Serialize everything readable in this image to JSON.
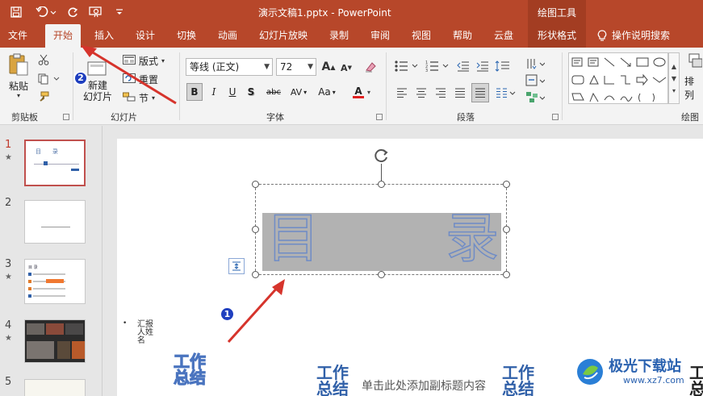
{
  "titlebar": {
    "save_icon": "save-icon",
    "undo_icon": "undo-icon",
    "redo_icon": "repeat-icon",
    "present_icon": "present-icon",
    "customize_icon": "customize-qat-icon",
    "doc_title": "演示文稿1.pptx - PowerPoint",
    "context_group": "绘图工具"
  },
  "tabs": [
    {
      "label": "文件"
    },
    {
      "label": "开始",
      "active": true
    },
    {
      "label": "插入"
    },
    {
      "label": "设计"
    },
    {
      "label": "切换"
    },
    {
      "label": "动画"
    },
    {
      "label": "幻灯片放映"
    },
    {
      "label": "录制"
    },
    {
      "label": "审阅"
    },
    {
      "label": "视图"
    },
    {
      "label": "帮助"
    },
    {
      "label": "云盘"
    },
    {
      "label": "形状格式"
    },
    {
      "label": "操作说明搜索"
    }
  ],
  "ribbon": {
    "clipboard": {
      "group_label": "剪贴板",
      "paste_label": "粘贴"
    },
    "slides": {
      "group_label": "幻灯片",
      "new_slide_label_1": "新建",
      "new_slide_label_2": "幻灯片",
      "layout_label": "版式",
      "reset_label": "重置",
      "section_label": "节"
    },
    "font": {
      "group_label": "字体",
      "font_name": "等线 (正文)",
      "font_size": "72",
      "bold": "B",
      "italic": "I",
      "underline": "U",
      "shadow": "S",
      "strike": "abc",
      "spacing": "AV",
      "case": "Aa",
      "font_color": "A",
      "grow": "A",
      "shrink": "A"
    },
    "paragraph": {
      "group_label": "段落"
    },
    "drawing": {
      "group_label": "绘图",
      "arrange_label": "排列"
    }
  },
  "colors": {
    "accent": "#b7472a",
    "ribbon_bg": "#f3f3f3",
    "arrow_red": "#d6342c",
    "badge_blue": "#1f3fbf",
    "title_fill": "#b2b2b2",
    "outline_blue": "#6f8cc6",
    "dark_blue": "#3060a8"
  },
  "badges": {
    "one": "1",
    "two": "2"
  },
  "thumbnails": [
    {
      "num": "1",
      "star": "★",
      "selected": true,
      "title": "目    录"
    },
    {
      "num": "2",
      "star": "",
      "selected": false
    },
    {
      "num": "3",
      "star": "★",
      "selected": false,
      "title": "目 录"
    },
    {
      "num": "4",
      "star": "★",
      "selected": false
    },
    {
      "num": "5",
      "star": "",
      "selected": false
    }
  ],
  "slide": {
    "title_left": "目",
    "title_right": "录",
    "reporter_bullet": "•",
    "reporter_lines": [
      "汇报",
      "人姓",
      "名"
    ],
    "art_text_1": "工作",
    "art_text_2": "总结",
    "subtitle_placeholder": "单击此处添加副标题内容",
    "art_edge_1": "工",
    "art_edge_2": "总"
  },
  "watermark": {
    "text": "极光下载站",
    "url": "www.xz7.com"
  }
}
